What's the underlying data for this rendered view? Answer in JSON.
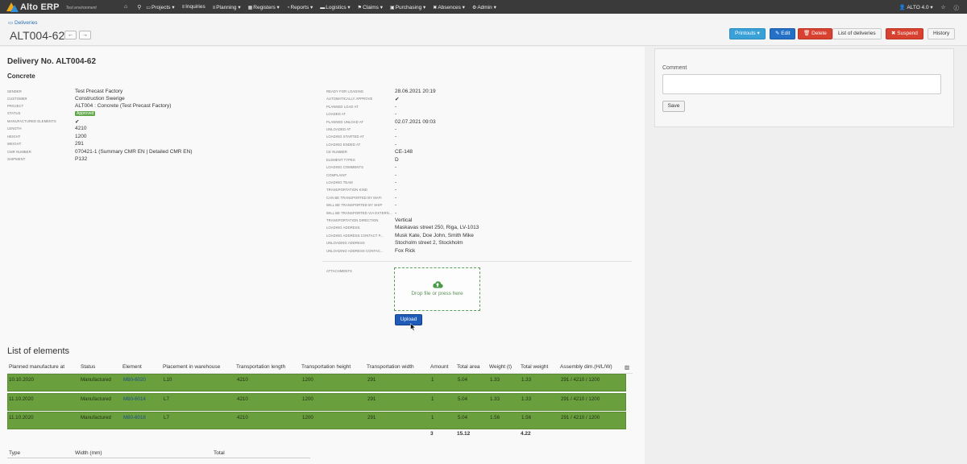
{
  "app": {
    "brand": "Alto ERP",
    "environment": "Test environment"
  },
  "nav": {
    "items": [
      {
        "icon": "folder-icon",
        "label": "Projects"
      },
      {
        "icon": "list-icon",
        "label": "Inquiries"
      },
      {
        "icon": "bars-icon",
        "label": "Planning"
      },
      {
        "icon": "table-icon",
        "label": "Registers"
      },
      {
        "icon": "chart-icon",
        "label": "Reports"
      },
      {
        "icon": "truck-icon",
        "label": "Logistics"
      },
      {
        "icon": "flag-icon",
        "label": "Claims"
      },
      {
        "icon": "cart-icon",
        "label": "Purchasing"
      },
      {
        "icon": "close-icon",
        "label": "Absences"
      },
      {
        "icon": "gear-icon",
        "label": "Admin"
      }
    ],
    "user": "ALTO 4.0"
  },
  "header": {
    "breadcrumb": "Deliveries",
    "title": "ALT004-62",
    "prev": "←",
    "next": "→",
    "buttons": {
      "printouts": "Printouts",
      "edit": "Edit",
      "delete": "Delete",
      "list": "List of deliveries",
      "suspend": "Suspend",
      "history": "History"
    }
  },
  "delivery": {
    "title": "Delivery No. ALT004-62",
    "subtitle": "Concrete",
    "left": [
      {
        "k": "Sender",
        "v": "Test Precast Factory"
      },
      {
        "k": "Customer",
        "v": "Construction Swerige"
      },
      {
        "k": "Project",
        "v": "ALT004 : Concrete (Test Precast Factory)"
      },
      {
        "k": "Status",
        "v": "Approved"
      },
      {
        "k": "Manufactured elements",
        "v": "✔"
      },
      {
        "k": "Length",
        "v": "4210"
      },
      {
        "k": "Height",
        "v": "1200"
      },
      {
        "k": "Weight",
        "v": "291"
      },
      {
        "k": "CMR number",
        "v": "070421-1",
        "links": [
          "Summary CMR EN",
          "Detailed CMR EN"
        ]
      },
      {
        "k": "Shipment",
        "v": "P132"
      }
    ],
    "right": [
      {
        "k": "Ready for loading",
        "v": "28.06.2021 20:19"
      },
      {
        "k": "Automatically approve",
        "v": "✔"
      },
      {
        "k": "Planned load at",
        "v": "-"
      },
      {
        "k": "Loaded at",
        "v": "-"
      },
      {
        "k": "Planned unload at",
        "v": "02.07.2021 09:03"
      },
      {
        "k": "Unloaded at",
        "v": "-"
      },
      {
        "k": "Loading started at",
        "v": "-"
      },
      {
        "k": "Loading ended at",
        "v": "-"
      },
      {
        "k": "CE number",
        "v": "CE-148"
      },
      {
        "k": "Element types",
        "v": "D"
      },
      {
        "k": "Loading comments",
        "v": "-"
      },
      {
        "k": "Complaint",
        "v": "-"
      },
      {
        "k": "Loading team",
        "v": "-"
      },
      {
        "k": "Transportation kind",
        "v": "-"
      },
      {
        "k": "Can be transported by mafi",
        "v": "-"
      },
      {
        "k": "Will be transported by ship",
        "v": "-"
      },
      {
        "k": "Will be transported via extern...",
        "v": "-"
      },
      {
        "k": "Transportation direction",
        "v": "Vertical"
      },
      {
        "k": "Loading address",
        "v": "Maskavas street 250, Riga, LV-1013"
      },
      {
        "k": "Loading address contact p...",
        "v": "Musk Kate, Doe John, Smith Mike"
      },
      {
        "k": "Unloading address",
        "v": "Stocholm street 2, Stockholm"
      },
      {
        "k": "Unloading address contac...",
        "v": "Fox Rick"
      }
    ],
    "attachments_label": "Attachments",
    "dropzone_label": "Drop file or press here",
    "upload_label": "Upload"
  },
  "comment": {
    "label": "Comment",
    "placeholder": "",
    "save": "Save"
  },
  "elements": {
    "title": "List of elements",
    "columns": [
      "Planned manufacture at",
      "Status",
      "Element",
      "Placement in warehouse",
      "Transportation length",
      "Transportation height",
      "Transportation width",
      "Amount",
      "Total area",
      "Weight (t)",
      "Total weight",
      "Assembly dim.(H/L/W)"
    ],
    "rows": [
      [
        "10.10.2020",
        "Manufactured",
        "M80-6020",
        "L10",
        "4210",
        "1200",
        "291",
        "1",
        "5.04",
        "1.33",
        "1.33",
        "291 / 4210 / 1200"
      ],
      [
        "11.10.2020",
        "Manufactured",
        "M80-6014",
        "L7",
        "4210",
        "1200",
        "291",
        "1",
        "5.04",
        "1.33",
        "1.33",
        "291 / 4210 / 1200"
      ],
      [
        "11.10.2020",
        "Manufactured",
        "M80-6018",
        "L7",
        "4210",
        "1200",
        "291",
        "1",
        "5.04",
        "1.56",
        "1.56",
        "291 / 4210 / 1200"
      ]
    ],
    "totals": {
      "amount": "3",
      "area": "15.12",
      "weight": "4.22"
    }
  },
  "summary": {
    "columns": [
      "Type",
      "Width (mm)",
      "Total"
    ]
  }
}
